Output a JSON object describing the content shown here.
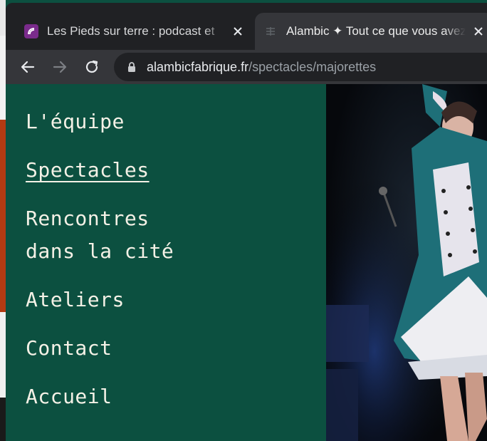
{
  "browser": {
    "tabs": [
      {
        "title": "Les Pieds sur terre : podcast et",
        "active": false,
        "favicon": "podcast-favicon"
      },
      {
        "title": "Alambic ✦ Tout ce que vous avez",
        "active": true,
        "favicon": "alambic-favicon"
      }
    ],
    "url": {
      "host": "alambicfabrique.fr",
      "path": "/spectacles/majorettes"
    }
  },
  "menu": {
    "items": [
      {
        "label": "L'équipe",
        "active": false
      },
      {
        "label": "Spectacles",
        "active": true
      },
      {
        "label_line1": "Rencontres",
        "label_line2": "dans la cité",
        "active": false
      },
      {
        "label": "Ateliers",
        "active": false
      },
      {
        "label": "Contact",
        "active": false
      },
      {
        "label": "Accueil",
        "active": false
      }
    ]
  },
  "colors": {
    "menu_background": "#0c5040",
    "menu_text": "#f4f1e6",
    "costume_teal": "#1e6f78",
    "photo_background": "#06080c"
  }
}
